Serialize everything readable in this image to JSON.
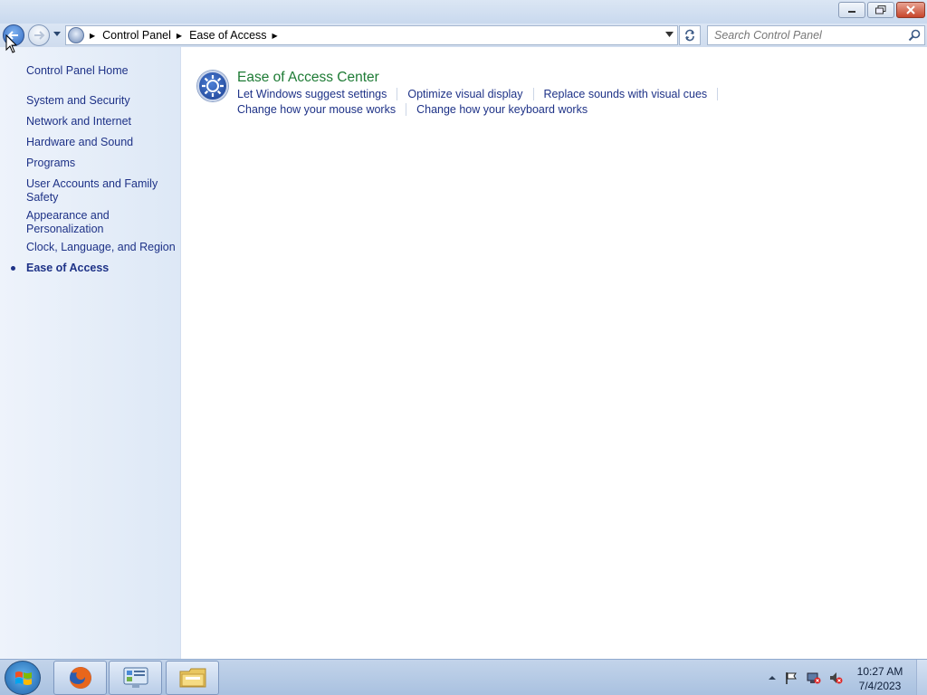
{
  "window": {
    "controls": [
      "minimize",
      "restore",
      "close"
    ]
  },
  "navbar": {
    "breadcrumbs": [
      "Control Panel",
      "Ease of Access"
    ],
    "search_placeholder": "Search Control Panel"
  },
  "sidebar": {
    "items": [
      {
        "label": "Control Panel Home"
      },
      {
        "label": "System and Security"
      },
      {
        "label": "Network and Internet"
      },
      {
        "label": "Hardware and Sound"
      },
      {
        "label": "Programs"
      },
      {
        "label": "User Accounts and Family Safety"
      },
      {
        "label": "Appearance and Personalization"
      },
      {
        "label": "Clock, Language, and Region"
      },
      {
        "label": "Ease of Access"
      }
    ],
    "current": "Ease of Access"
  },
  "main": {
    "category": {
      "title": "Ease of Access Center",
      "links_row1": [
        "Let Windows suggest settings",
        "Optimize visual display",
        "Replace sounds with visual cues"
      ],
      "links_row2": [
        "Change how your mouse works",
        "Change how your keyboard works"
      ]
    }
  },
  "taskbar": {
    "pinned": [
      "firefox-icon",
      "control-panel-icon",
      "windows-explorer-icon"
    ],
    "clock_time": "10:27 AM",
    "clock_date": "7/4/2023"
  },
  "colors": {
    "link": "#1e3287",
    "category_title": "#1e7b35",
    "sidebar_bg": "#e4edf8"
  }
}
